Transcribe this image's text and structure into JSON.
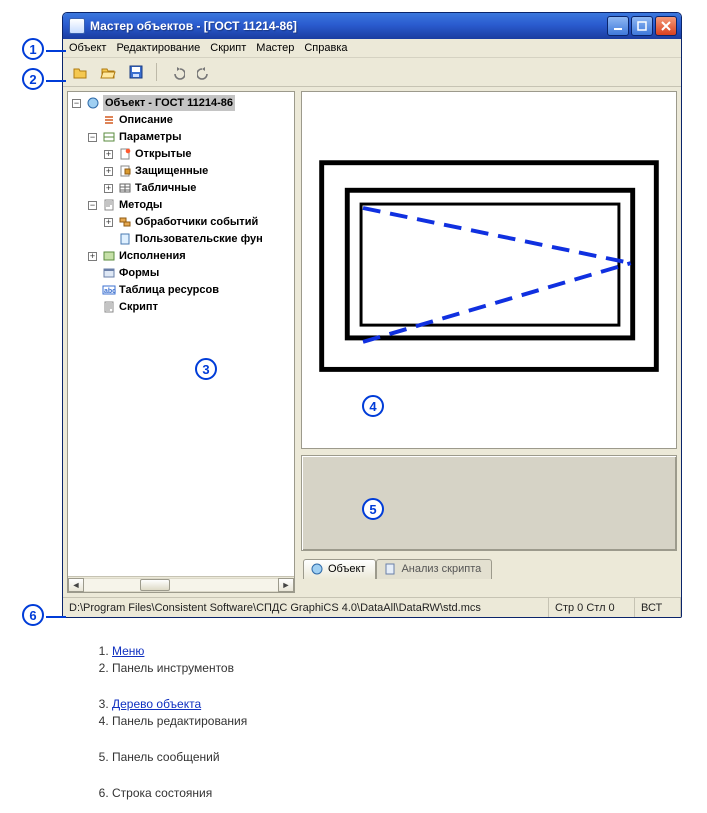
{
  "window": {
    "title": "Мастер объектов - [ГОСТ 11214-86]"
  },
  "menu": {
    "items": [
      "Объект",
      "Редактирование",
      "Скрипт",
      "Мастер",
      "Справка"
    ]
  },
  "toolbar": {
    "open": "open",
    "open2": "open-folder",
    "save": "save",
    "undo": "undo",
    "redo": "redo"
  },
  "tree": {
    "root": "Объект - ГОСТ 11214-86",
    "description": "Описание",
    "parameters": "Параметры",
    "param_open": "Открытые",
    "param_protected": "Защищенные",
    "param_table": "Табличные",
    "methods": "Методы",
    "method_handlers": "Обработчики событий",
    "method_userfns": "Пользовательские фун",
    "implementations": "Исполнения",
    "forms": "Формы",
    "res_table": "Таблица ресурсов",
    "script": "Скрипт"
  },
  "tabs": {
    "object": "Объект",
    "script_analysis": "Анализ скрипта"
  },
  "status": {
    "path": "D:\\Program Files\\Consistent Software\\СПДС GraphiCS 4.0\\DataAll\\DataRW\\std.mcs",
    "pos": "Стр 0 Стл 0",
    "ins": "ВСТ"
  },
  "legend": {
    "1": "Меню",
    "2": "Панель инструментов",
    "3": "Дерево объекта",
    "4": "Панель редактирования",
    "5": "Панель сообщений",
    "6": "Строка состояния"
  }
}
